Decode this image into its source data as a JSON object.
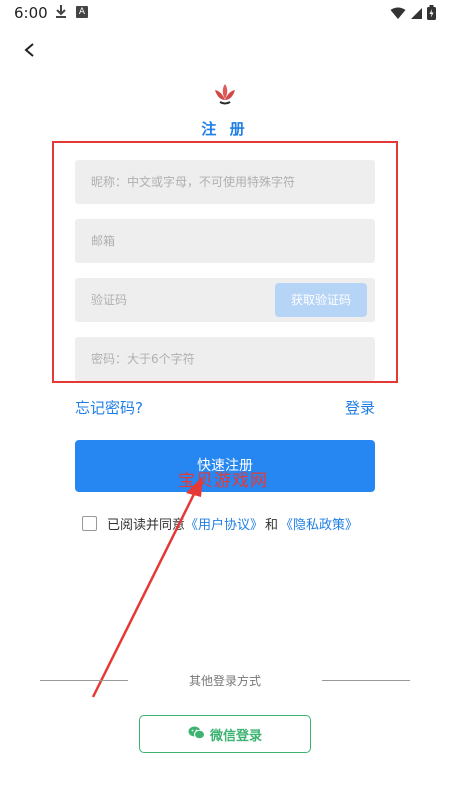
{
  "status_bar": {
    "time": "6:00",
    "small_icon_letter": "A"
  },
  "header": {
    "title": "注 册"
  },
  "form": {
    "nickname_placeholder": "昵称：中文或字母，不可使用特殊字符",
    "email_placeholder": "邮箱",
    "code_placeholder": "验证码",
    "get_code_label": "获取验证码",
    "password_placeholder": "密码：大于6个字符"
  },
  "links": {
    "forgot": "忘记密码?",
    "login": "登录"
  },
  "register_label": "快速注册",
  "agreement": {
    "prefix": "已阅读并同意",
    "user_agreement": "《用户协议》",
    "and": "和",
    "privacy_policy": "《隐私政策》"
  },
  "other_login": {
    "label": "其他登录方式",
    "wechat_label": "微信登录"
  },
  "watermark": "宝贝游戏网",
  "colors": {
    "accent": "#2687f3",
    "link": "#1f7fe6",
    "wechat": "#3cb371",
    "highlight": "#e53935",
    "field_bg": "#eeeeee"
  }
}
